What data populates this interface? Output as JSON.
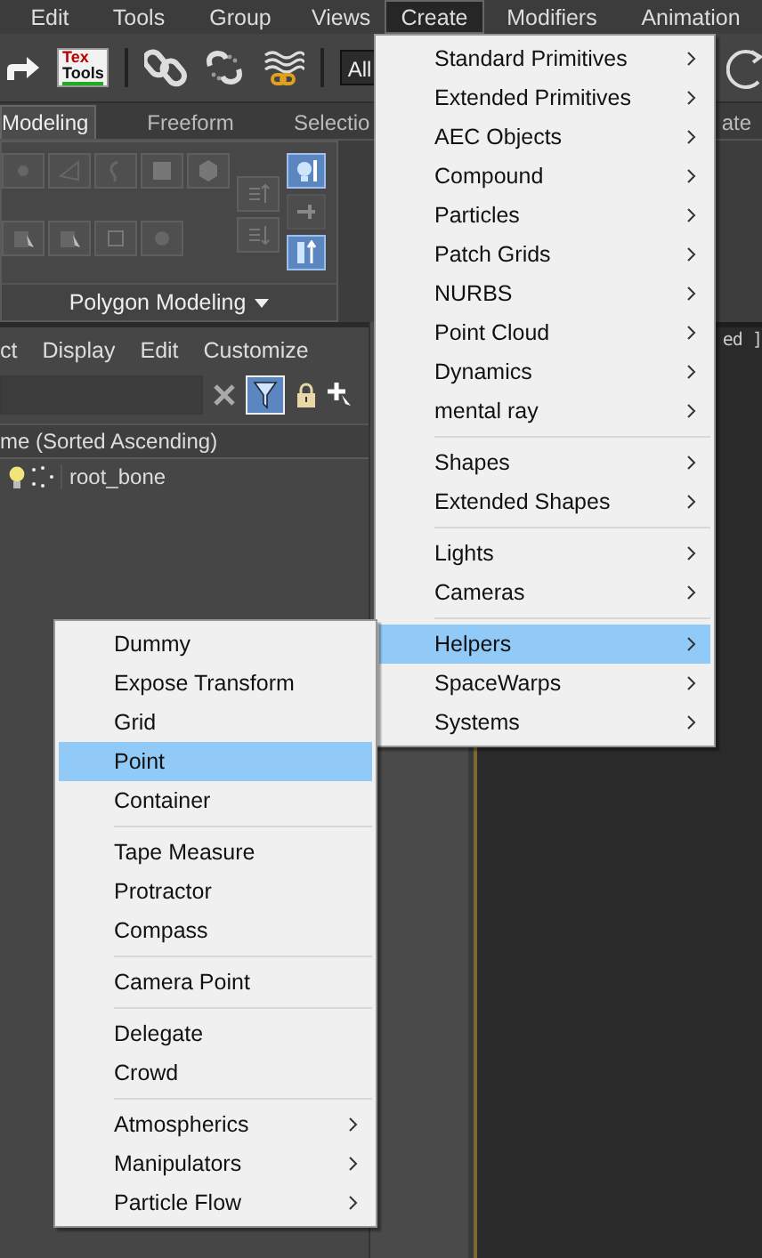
{
  "menu_bar": [
    {
      "label": "Edit",
      "selected": false
    },
    {
      "label": "Tools",
      "selected": false
    },
    {
      "label": "Group",
      "selected": false
    },
    {
      "label": "Views",
      "selected": false
    },
    {
      "label": "Create",
      "selected": true
    },
    {
      "label": "Modifiers",
      "selected": false
    },
    {
      "label": "Animation",
      "selected": false
    }
  ],
  "toolbar": {
    "logo_text": [
      "Tex",
      "Tools"
    ],
    "selection_filter": "All"
  },
  "ribbon": {
    "tabs": [
      {
        "label": "Modeling",
        "selected": true
      },
      {
        "label": "Freeform",
        "selected": false
      },
      {
        "label": "Selectio",
        "selected": false
      },
      {
        "label": "ate",
        "selected": false
      }
    ],
    "panel_title": "Polygon Modeling",
    "toggles": [
      {
        "on": true
      },
      {
        "on": false
      },
      {
        "on": true
      }
    ]
  },
  "scene_explorer": {
    "menu": [
      "ct",
      "Display",
      "Edit",
      "Customize"
    ],
    "filter_on": true,
    "column_header": "me (Sorted Ascending)",
    "rows": [
      {
        "name": "root_bone"
      }
    ]
  },
  "viewport": {
    "label": "ed ]"
  },
  "create_menu": {
    "groups": [
      {
        "items": [
          {
            "label": "Standard Primitives",
            "selected": false,
            "submenu": true
          },
          {
            "label": "Extended Primitives",
            "selected": false,
            "submenu": true
          },
          {
            "label": "AEC Objects",
            "selected": false,
            "submenu": true
          },
          {
            "label": "Compound",
            "selected": false,
            "submenu": true
          },
          {
            "label": "Particles",
            "selected": false,
            "submenu": true
          },
          {
            "label": "Patch Grids",
            "selected": false,
            "submenu": true
          },
          {
            "label": "NURBS",
            "selected": false,
            "submenu": true
          },
          {
            "label": "Point Cloud",
            "selected": false,
            "submenu": true
          },
          {
            "label": "Dynamics",
            "selected": false,
            "submenu": true
          },
          {
            "label": "mental ray",
            "selected": false,
            "submenu": true
          }
        ]
      },
      {
        "items": [
          {
            "label": "Shapes",
            "selected": false,
            "submenu": true
          },
          {
            "label": "Extended Shapes",
            "selected": false,
            "submenu": true
          }
        ]
      },
      {
        "items": [
          {
            "label": "Lights",
            "selected": false,
            "submenu": true
          },
          {
            "label": "Cameras",
            "selected": false,
            "submenu": true
          }
        ]
      },
      {
        "items": [
          {
            "label": "Helpers",
            "selected": true,
            "submenu": true
          },
          {
            "label": "SpaceWarps",
            "selected": false,
            "submenu": true
          },
          {
            "label": "Systems",
            "selected": false,
            "submenu": true
          }
        ]
      }
    ]
  },
  "helpers_submenu": {
    "groups": [
      {
        "items": [
          {
            "label": "Dummy",
            "selected": false,
            "submenu": false
          },
          {
            "label": "Expose Transform",
            "selected": false,
            "submenu": false
          },
          {
            "label": "Grid",
            "selected": false,
            "submenu": false
          },
          {
            "label": "Point",
            "selected": true,
            "submenu": false
          },
          {
            "label": "Container",
            "selected": false,
            "submenu": false
          }
        ]
      },
      {
        "items": [
          {
            "label": "Tape Measure",
            "selected": false,
            "submenu": false
          },
          {
            "label": "Protractor",
            "selected": false,
            "submenu": false
          },
          {
            "label": "Compass",
            "selected": false,
            "submenu": false
          }
        ]
      },
      {
        "items": [
          {
            "label": "Camera Point",
            "selected": false,
            "submenu": false
          }
        ]
      },
      {
        "items": [
          {
            "label": "Delegate",
            "selected": false,
            "submenu": false
          },
          {
            "label": "Crowd",
            "selected": false,
            "submenu": false
          }
        ]
      },
      {
        "items": [
          {
            "label": "Atmospherics",
            "selected": false,
            "submenu": true
          },
          {
            "label": "Manipulators",
            "selected": false,
            "submenu": true
          },
          {
            "label": "Particle Flow",
            "selected": false,
            "submenu": true
          }
        ]
      }
    ]
  }
}
